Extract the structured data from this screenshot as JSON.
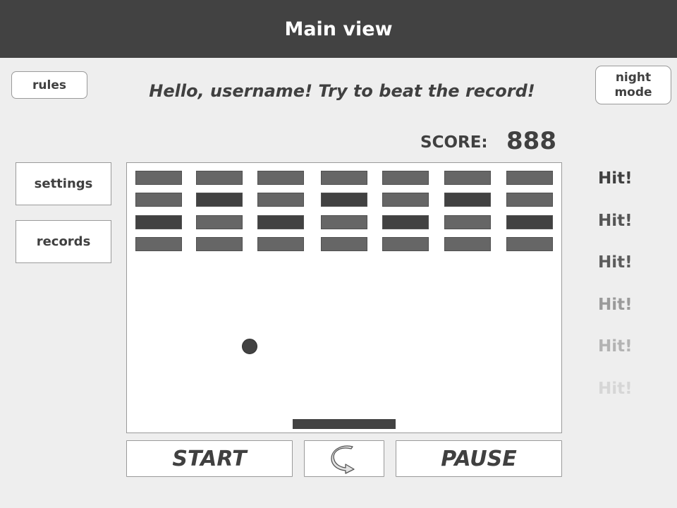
{
  "header": {
    "title": "Main view"
  },
  "buttons": {
    "rules": "rules",
    "night_mode": [
      "night",
      "mode"
    ],
    "settings": "settings",
    "records": "records",
    "start": "START",
    "pause": "PAUSE",
    "restart_icon": "restart-icon"
  },
  "greeting": "Hello, username! Try to beat the record!",
  "score": {
    "label": "SCORE:",
    "value": "888"
  },
  "bricks": [
    [
      "light",
      "light",
      "light",
      "light",
      "light",
      "light",
      "light"
    ],
    [
      "light",
      "dark",
      "light",
      "dark",
      "light",
      "dark",
      "light"
    ],
    [
      "dark",
      "light",
      "dark",
      "light",
      "dark",
      "light",
      "dark"
    ],
    [
      "light",
      "light",
      "light",
      "light",
      "light",
      "light",
      "light"
    ]
  ],
  "hits": [
    {
      "text": "Hit!",
      "color": "#404040"
    },
    {
      "text": "Hit!",
      "color": "#555555"
    },
    {
      "text": "Hit!",
      "color": "#5c5c5c"
    },
    {
      "text": "Hit!",
      "color": "#9a9a9a"
    },
    {
      "text": "Hit!",
      "color": "#b3b3b3"
    },
    {
      "text": "Hit!",
      "color": "#d6d6d6"
    }
  ],
  "colors": {
    "header_bg": "#424242",
    "background": "#eeeeee",
    "brick_light": "#666666",
    "brick_dark": "#424242"
  }
}
